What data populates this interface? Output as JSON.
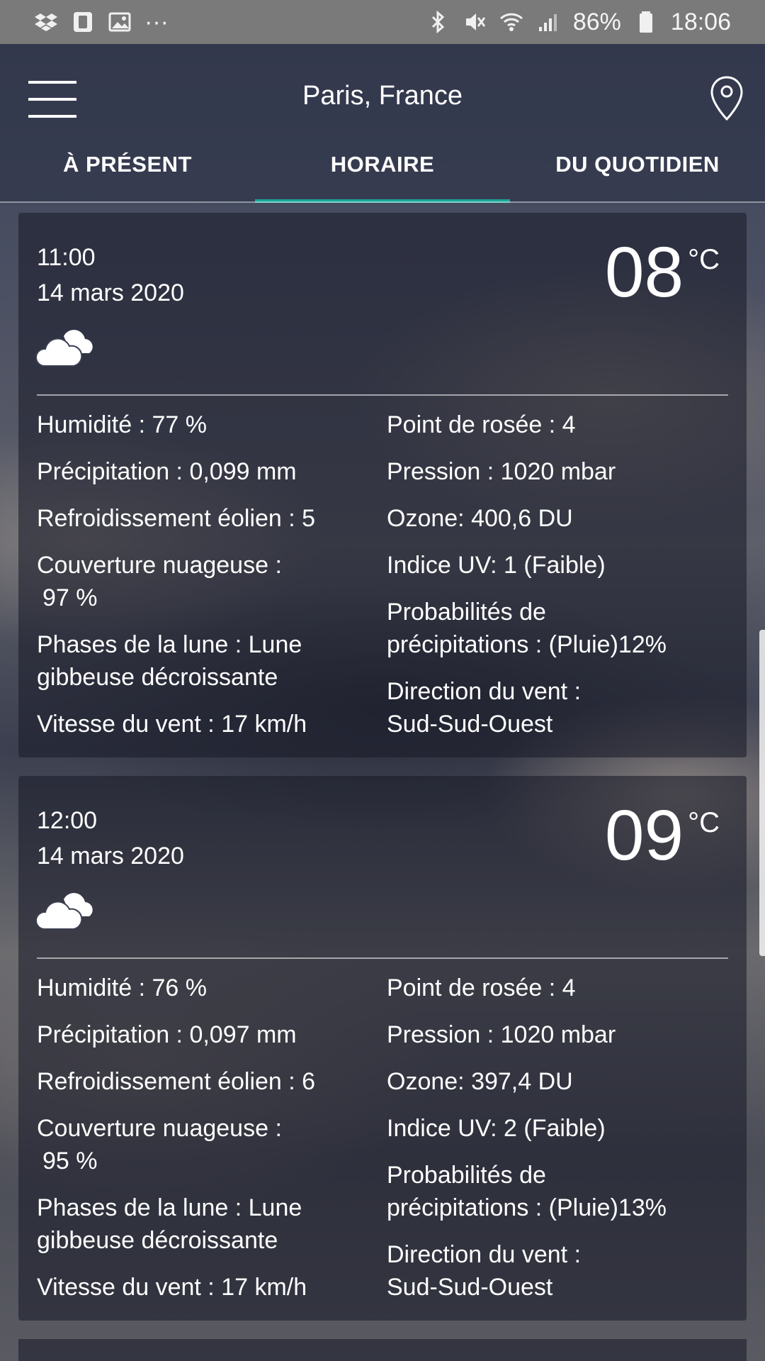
{
  "status_bar": {
    "battery": "86%",
    "time": "18:06",
    "dots": "···"
  },
  "header": {
    "title": "Paris, France",
    "tabs": [
      {
        "label": "À PRÉSENT",
        "active": false
      },
      {
        "label": "HORAIRE",
        "active": true
      },
      {
        "label": "DU QUOTIDIEN",
        "active": false
      }
    ]
  },
  "accent_color": "#1aa89a",
  "cards": [
    {
      "time": "11:00",
      "date": "14 mars 2020",
      "temp": "08",
      "unit": "°C",
      "icon": "cloud-icon",
      "left": [
        "Humidité : 77 %",
        "Précipitation : 0,099 mm",
        "Refroidissement éolien : 5",
        "Couverture nuageuse :",
        "97 %",
        "Phases de la lune : Lune",
        "gibbeuse décroissante",
        "Vitesse du vent : 17 km/h"
      ],
      "right": [
        "Point de rosée : 4",
        "Pression : 1020 mbar",
        "Ozone: 400,6 DU",
        "Indice UV: 1 (Faible)",
        "Probabilités de",
        "précipitations : (Pluie)12%",
        "Direction du vent :",
        "Sud-Sud-Ouest"
      ]
    },
    {
      "time": "12:00",
      "date": "14 mars 2020",
      "temp": "09",
      "unit": "°C",
      "icon": "cloud-icon",
      "left": [
        "Humidité : 76 %",
        "Précipitation : 0,097 mm",
        "Refroidissement éolien : 6",
        "Couverture nuageuse :",
        "95 %",
        "Phases de la lune : Lune",
        "gibbeuse décroissante",
        "Vitesse du vent : 17 km/h"
      ],
      "right": [
        "Point de rosée : 4",
        "Pression : 1020 mbar",
        "Ozone: 397,4 DU",
        "Indice UV: 2 (Faible)",
        "Probabilités de",
        "précipitations : (Pluie)13%",
        "Direction du vent :",
        "Sud-Sud-Ouest"
      ]
    }
  ]
}
